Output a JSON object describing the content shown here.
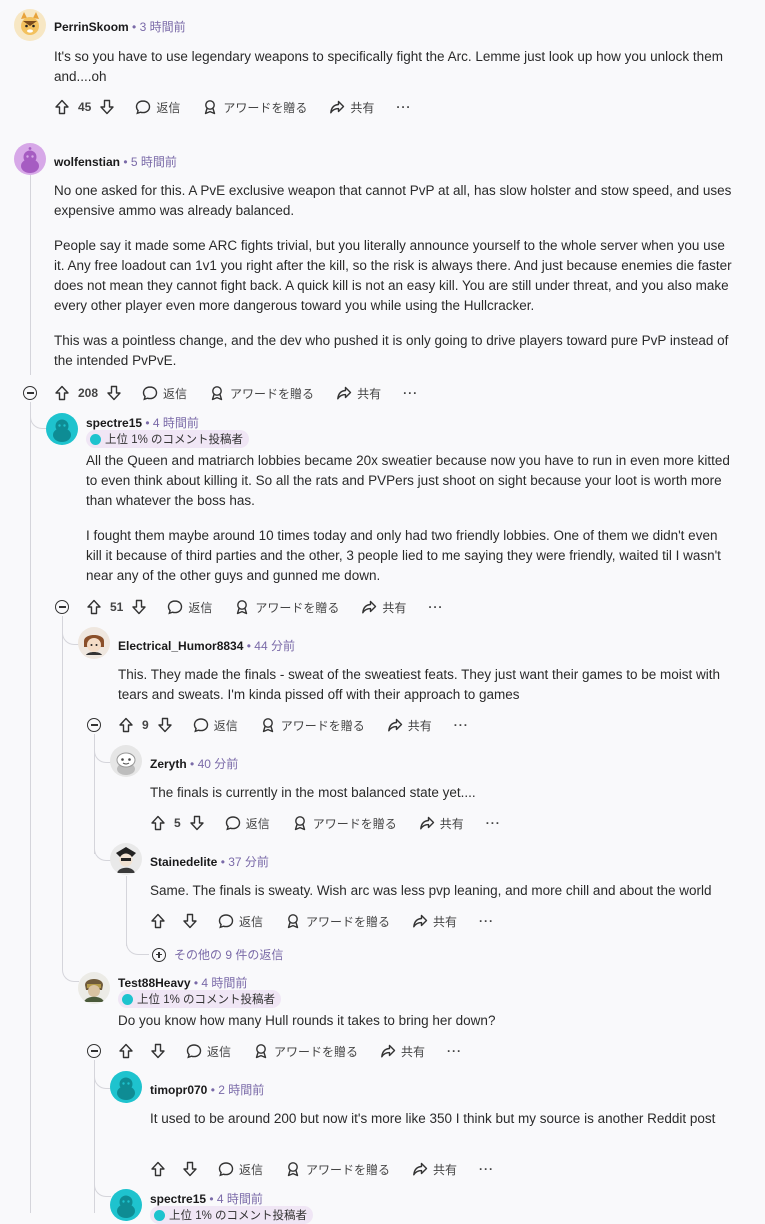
{
  "labels": {
    "reply": "返信",
    "award": "アワードを贈る",
    "share": "共有",
    "more": "···",
    "flair": "上位 1% のコメント投稿者",
    "flair_partial": "上位 1% のコメント投稿者"
  },
  "comments": [
    {
      "user": "PerrinSkoom",
      "time": "• 3 時間前",
      "score": "45",
      "body": [
        "It's so you have to use legendary weapons to specifically fight the Arc. Lemme just look up how you unlock them and....oh"
      ]
    },
    {
      "user": "wolfenstian",
      "time": "• 5 時間前",
      "score": "208",
      "body": [
        "No one asked for this. A PvE exclusive weapon that cannot PvP at all, has slow holster and stow speed, and uses expensive ammo was already balanced.",
        "People say it made some ARC fights trivial, but you literally announce yourself to the whole server when you use it. Any free loadout can 1v1 you right after the kill, so the risk is always there. And just because enemies die faster does not mean they cannot fight back. A quick kill is not an easy kill. You are still under threat, and you also make every other player even more dangerous toward you while using the Hullcracker.",
        "This was a pointless change, and the dev who pushed it is only going to drive players toward pure PvP instead of the intended PvPvE."
      ]
    },
    {
      "user": "spectre15",
      "time": "• 4 時間前",
      "score": "51",
      "body": [
        "All the Queen and matriarch lobbies became 20x sweatier because now you have to run in even more kitted to even think about killing it. So all the rats and PVPers just shoot on sight because your loot is worth more than whatever the boss has.",
        "I fought them maybe around 10 times today and only had two friendly lobbies. One of them we didn't even kill it because of third parties and the other, 3 people lied to me saying they were friendly, waited til I wasn't near any of the other guys and gunned me down."
      ]
    },
    {
      "user": "Electrical_Humor8834",
      "time": "• 44 分前",
      "score": "9",
      "body": [
        "This. They made the finals - sweat of the sweatiest feats. They just want their games to be moist with tears and sweats. I'm kinda pissed off with their approach to games"
      ]
    },
    {
      "user": "Zeryth",
      "time": "• 40 分前",
      "score": "5",
      "body": [
        "The finals is currently in the most balanced state yet...."
      ]
    },
    {
      "user": "Stainedelite",
      "time": "• 37 分前",
      "score": "",
      "body": [
        "Same. The finals is sweaty. Wish arc was less pvp leaning, and more chill and about the world"
      ]
    },
    {
      "user": "Test88Heavy",
      "time": "• 4 時間前",
      "score": "",
      "body": [
        "Do you know how many Hull rounds it takes to bring her down?"
      ]
    },
    {
      "user": "timopr070",
      "time": "• 2 時間前",
      "score": "",
      "body": [
        "It used to be around 200 but now it's more like 350 I think but my source is another Reddit post"
      ]
    },
    {
      "user": "spectre15",
      "time": "• 4 時間前"
    }
  ],
  "more_replies": "その他の 9 件の返信",
  "colors": {
    "background": "#f9f9fb",
    "time": "#7a6aa8",
    "flair_bg": "#f0e6f5",
    "avatar_teal": "#1ec3ce"
  }
}
